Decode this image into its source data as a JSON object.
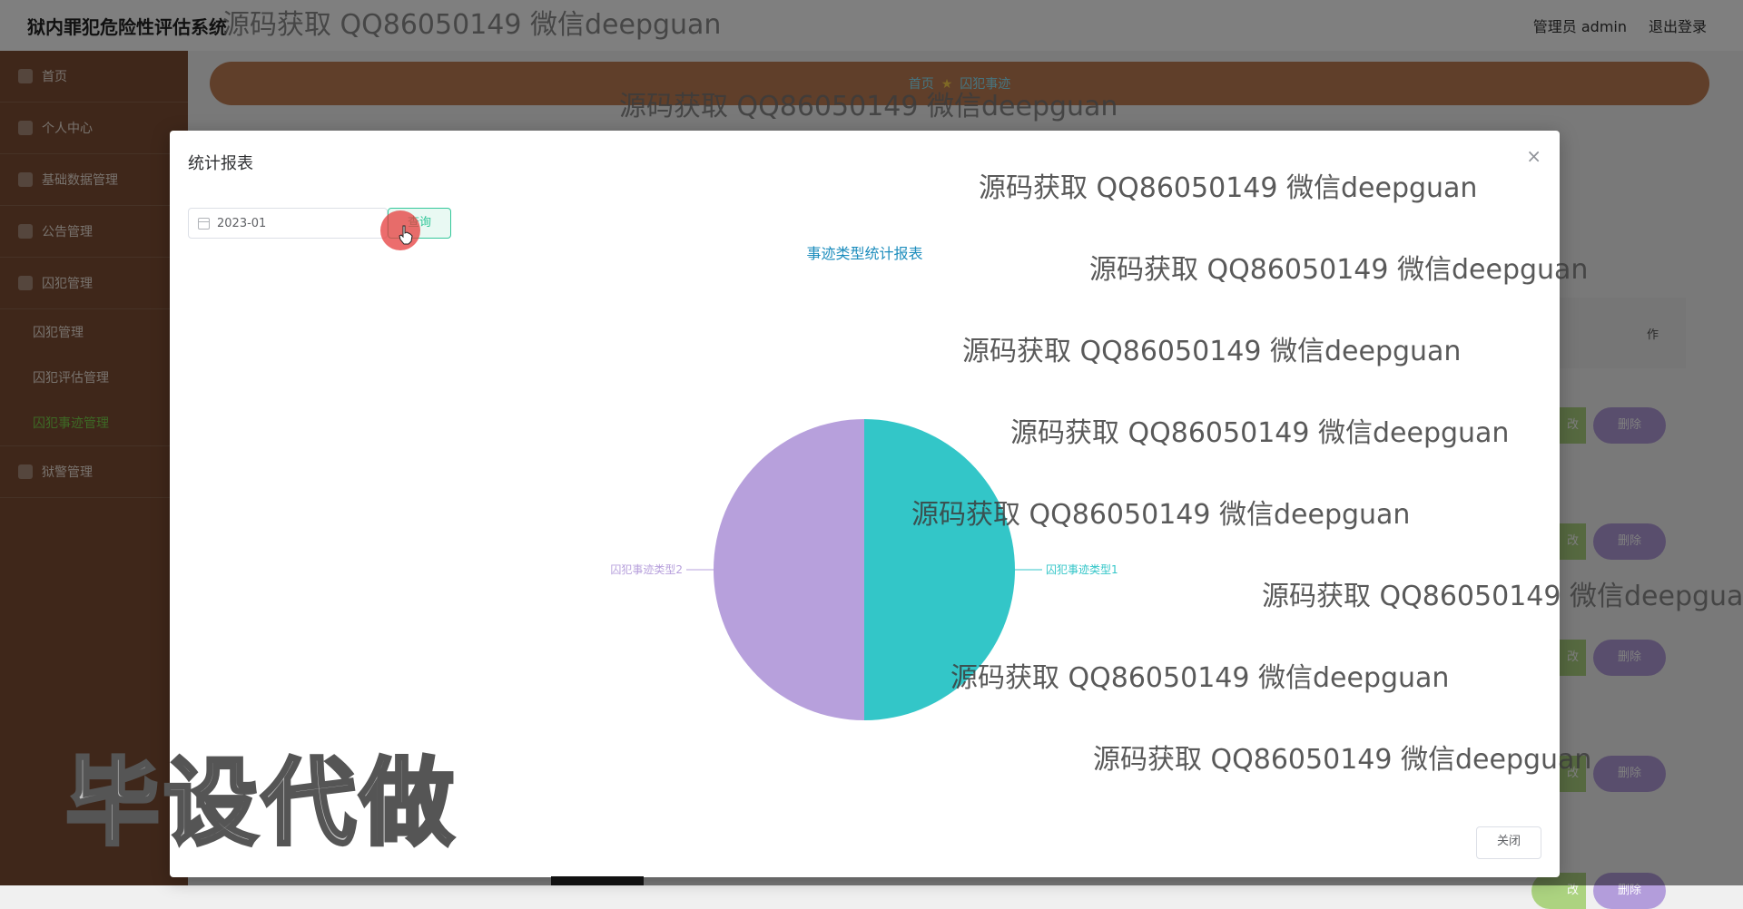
{
  "header": {
    "title": "狱内罪犯危险性评估系统",
    "admin": "管理员 admin",
    "logout": "退出登录"
  },
  "sidebar": {
    "items": [
      {
        "label": "首页"
      },
      {
        "label": "个人中心"
      },
      {
        "label": "基础数据管理"
      },
      {
        "label": "公告管理"
      },
      {
        "label": "囚犯管理"
      }
    ],
    "subitems": [
      {
        "label": "囚犯管理"
      },
      {
        "label": "囚犯评估管理"
      },
      {
        "label": "囚犯事迹管理"
      }
    ],
    "last_item": {
      "label": "狱警管理"
    }
  },
  "breadcrumb": {
    "home": "首页",
    "current": "囚犯事迹"
  },
  "table": {
    "header_partial": "作",
    "edit_partial": "改",
    "delete_label": "删除"
  },
  "modal": {
    "title": "统计报表",
    "date_value": "2023-01",
    "query_label": "查询",
    "close_label": "关闭",
    "close_icon": "×"
  },
  "chart_data": {
    "type": "pie",
    "title": "事迹类型统计报表",
    "categories": [
      "囚犯事迹类型1",
      "囚犯事迹类型2"
    ],
    "values": [
      1,
      1
    ],
    "colors": [
      "#33c6c8",
      "#b7a0dc"
    ]
  },
  "watermarks": {
    "text": "源码获取 QQ86050149 微信deepguan",
    "big": "毕设代做"
  }
}
